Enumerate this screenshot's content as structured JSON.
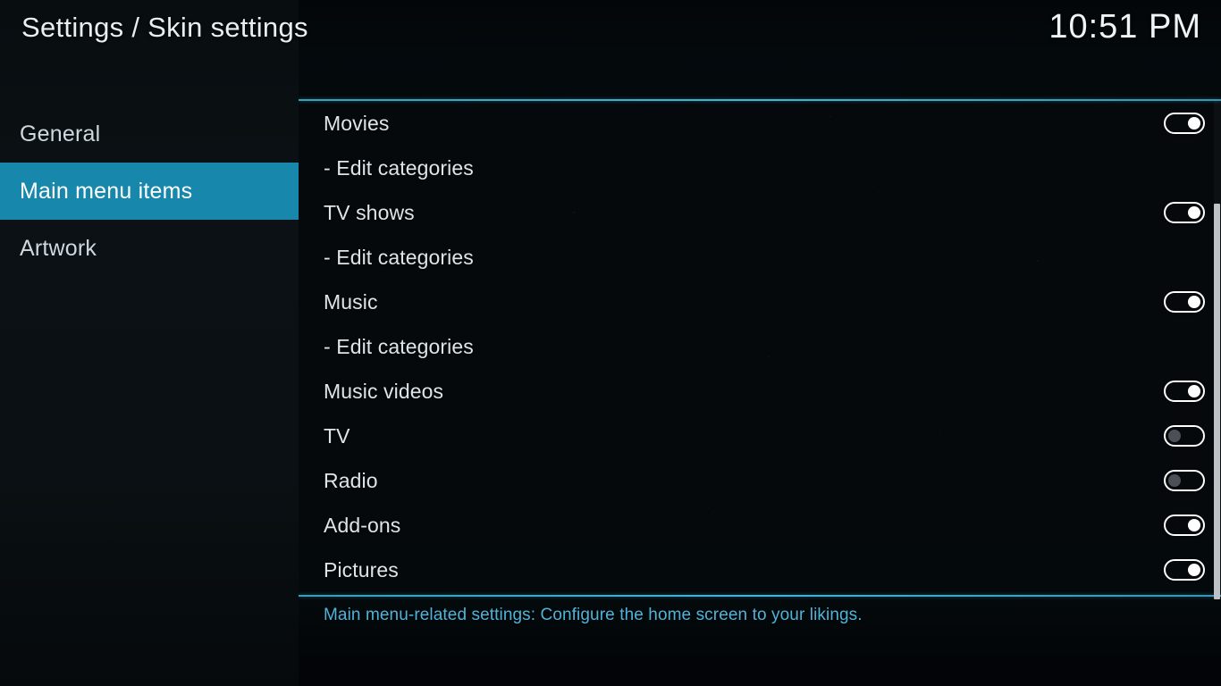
{
  "header": {
    "title": "Settings / Skin settings",
    "clock": "10:51 PM"
  },
  "sidebar": {
    "items": [
      {
        "label": "General",
        "selected": false
      },
      {
        "label": "Main menu items",
        "selected": true
      },
      {
        "label": "Artwork",
        "selected": false
      }
    ]
  },
  "main": {
    "rows": [
      {
        "label": "Movies",
        "control": "toggle",
        "state": "on"
      },
      {
        "label": "- Edit categories",
        "control": "none",
        "state": ""
      },
      {
        "label": "TV shows",
        "control": "toggle",
        "state": "on"
      },
      {
        "label": "- Edit categories",
        "control": "none",
        "state": ""
      },
      {
        "label": "Music",
        "control": "toggle",
        "state": "on"
      },
      {
        "label": "- Edit categories",
        "control": "none",
        "state": ""
      },
      {
        "label": "Music videos",
        "control": "toggle",
        "state": "on"
      },
      {
        "label": "TV",
        "control": "toggle",
        "state": "off"
      },
      {
        "label": "Radio",
        "control": "toggle",
        "state": "off"
      },
      {
        "label": "Add-ons",
        "control": "toggle",
        "state": "on"
      },
      {
        "label": "Pictures",
        "control": "toggle",
        "state": "on"
      }
    ],
    "description": "Main menu-related settings: Configure the home screen to your likings."
  },
  "colors": {
    "accent": "#1787ab",
    "rule": "#46becf",
    "description_text": "#4fb4d8",
    "toggle_on_knob": "#ffffff",
    "toggle_off_knob": "#4a5055",
    "scrollbar_thumb": "#bcc2c6"
  }
}
